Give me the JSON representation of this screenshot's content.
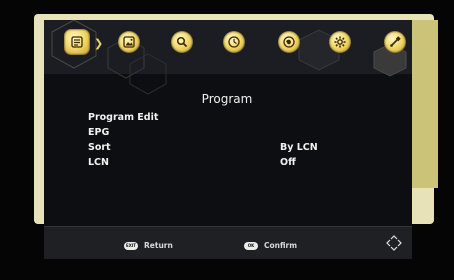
{
  "tabs": [
    {
      "name": "program-icon",
      "active": true
    },
    {
      "name": "picture-icon"
    },
    {
      "name": "channel-search-icon"
    },
    {
      "name": "time-icon"
    },
    {
      "name": "option-icon"
    },
    {
      "name": "system-icon"
    },
    {
      "name": "usb-icon"
    }
  ],
  "menu": {
    "title": "Program",
    "items": [
      {
        "label": "Program Edit",
        "value": ""
      },
      {
        "label": "EPG",
        "value": ""
      },
      {
        "label": "Sort",
        "value": "By LCN"
      },
      {
        "label": "LCN",
        "value": "Off"
      }
    ]
  },
  "footer": {
    "return_key": "EXIT",
    "return_label": "Return",
    "confirm_key": "OK",
    "confirm_label": "Confirm"
  },
  "colors": {
    "accent": "#f3d96a",
    "panel": "#0d0e11",
    "frame": "#e7e2b8"
  }
}
